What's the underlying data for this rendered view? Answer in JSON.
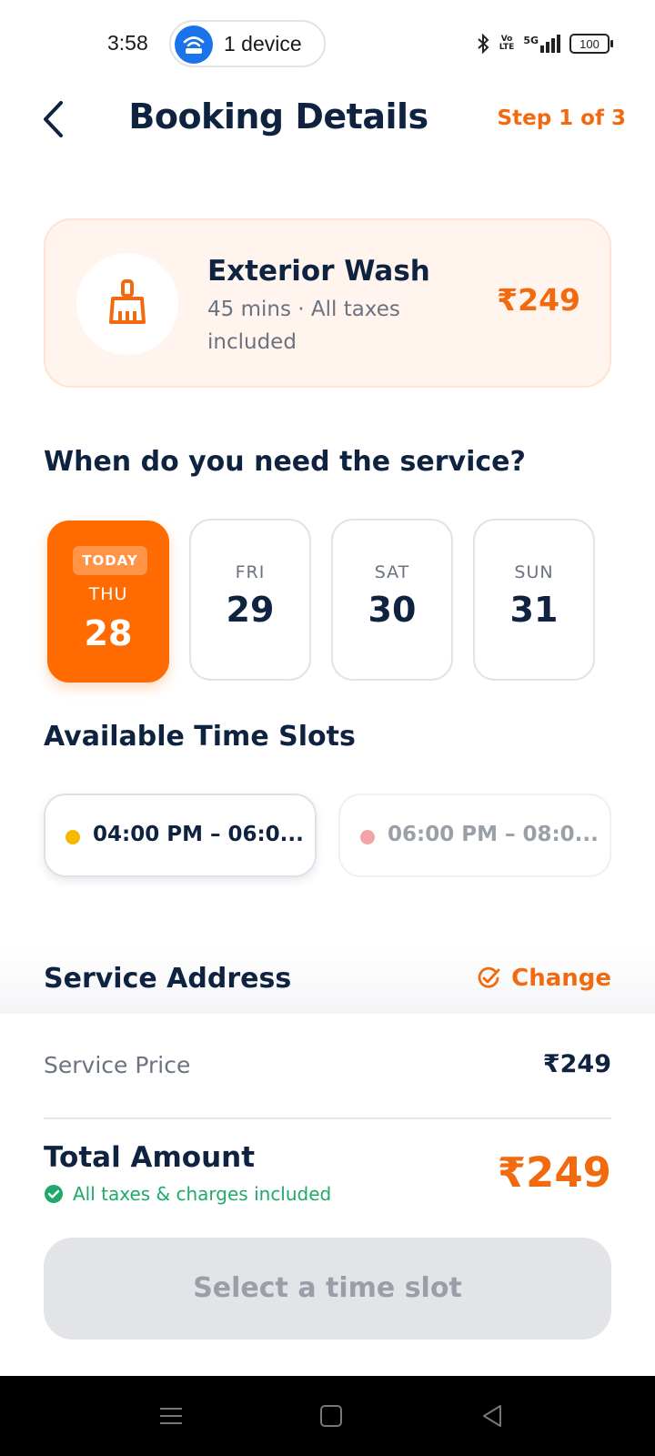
{
  "status_bar": {
    "time": "3:58",
    "hotspot_label": "1 device",
    "network_label": "5G",
    "volte_top": "Vo",
    "volte_bottom": "LTE",
    "battery": "100"
  },
  "header": {
    "title": "Booking Details",
    "step": "Step 1 of 3"
  },
  "service": {
    "name": "Exterior Wash",
    "meta": "45 mins · All taxes included",
    "price": "₹249"
  },
  "schedule": {
    "title": "When do you need the service?",
    "dates": [
      {
        "badge": "TODAY",
        "day": "THU",
        "date": "28",
        "selected": true
      },
      {
        "day": "FRI",
        "date": "29",
        "selected": false
      },
      {
        "day": "SAT",
        "date": "30",
        "selected": false
      },
      {
        "day": "SUN",
        "date": "31",
        "selected": false
      }
    ]
  },
  "slots": {
    "title": "Available Time Slots",
    "items": [
      {
        "label": "04:00 PM – 06:0...",
        "status_color": "#f5b800"
      },
      {
        "label": "06:00 PM – 08:0...",
        "status_color": "#f2a3a8"
      }
    ]
  },
  "address": {
    "title": "Service Address",
    "change_label": "Change"
  },
  "summary": {
    "price_label": "Service Price",
    "price_value": "₹249",
    "total_label": "Total Amount",
    "tax_note": "All taxes & charges included",
    "total_value": "₹249"
  },
  "cta": {
    "label": "Select a time slot"
  },
  "colors": {
    "accent": "#f26a10",
    "primary_text": "#0f2340",
    "success": "#1faa6b"
  }
}
